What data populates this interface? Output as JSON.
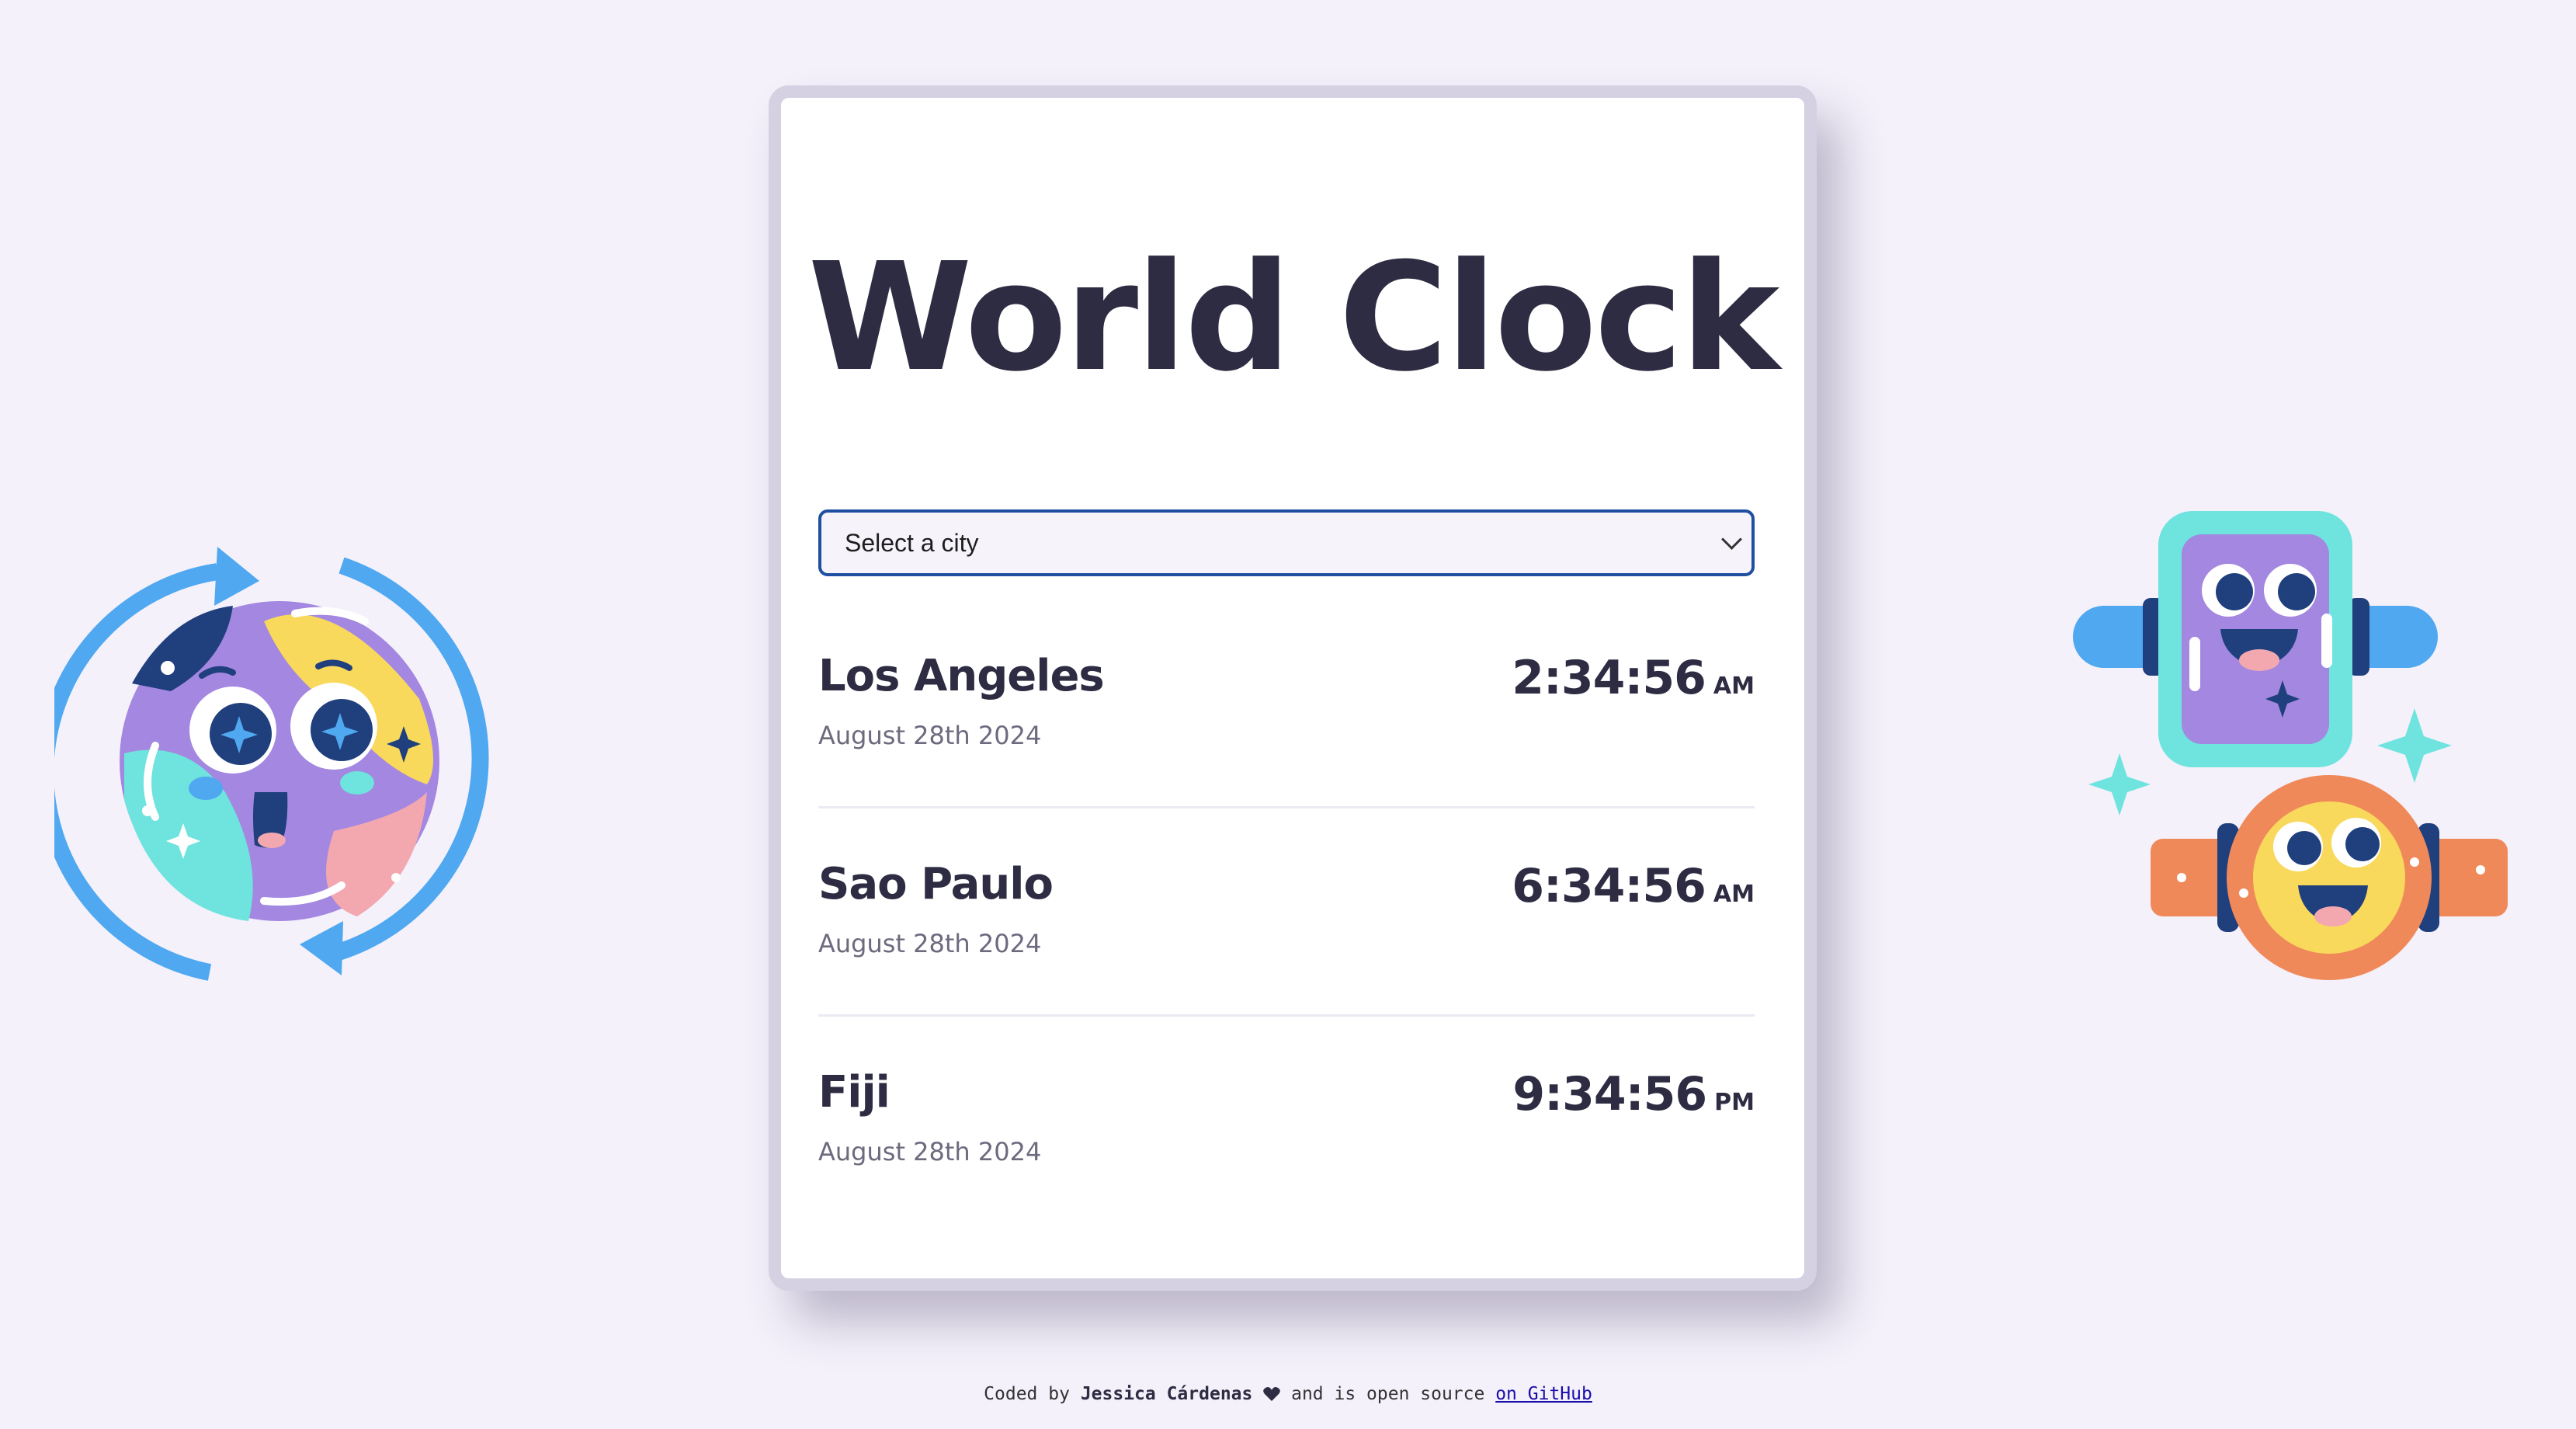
{
  "app": {
    "title": "World Clock"
  },
  "selector": {
    "label": "Select a city"
  },
  "cities": [
    {
      "name": "Los Angeles",
      "date": "August 28th 2024",
      "time": "2:34:56",
      "ampm": "AM"
    },
    {
      "name": "Sao Paulo",
      "date": "August 28th 2024",
      "time": "6:34:56",
      "ampm": "AM"
    },
    {
      "name": "Fiji",
      "date": "August 28th 2024",
      "time": "9:34:56",
      "ampm": "PM"
    }
  ],
  "footer": {
    "prefix": "Coded by",
    "author": "Jessica Cárdenas",
    "middle": "and is open source",
    "link_text": "on GitHub"
  },
  "colors": {
    "background": "#f4f1fb",
    "text": "#2e2c42",
    "accent": "#1f4fa0",
    "muted": "#6d6a7e"
  },
  "icons": [
    "globe-illustration",
    "watch-illustration",
    "heart-icon",
    "chevron-down-icon"
  ]
}
